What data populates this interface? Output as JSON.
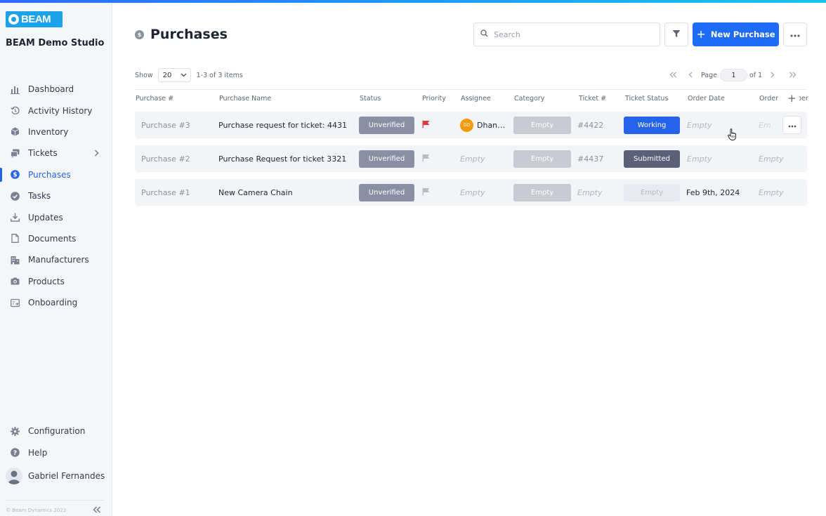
{
  "app": {
    "logo_text": "BEAM",
    "studio_name": "BEAM Demo Studio",
    "copyright": "© Beam Dynamics 2023",
    "accent_color": "#1e6cf5",
    "logo_color": "#1aa3ea"
  },
  "sidebar": {
    "items": [
      {
        "label": "Dashboard",
        "icon": "bar-chart-icon"
      },
      {
        "label": "Activity History",
        "icon": "history-icon"
      },
      {
        "label": "Inventory",
        "icon": "box-icon"
      },
      {
        "label": "Tickets",
        "icon": "tickets-icon",
        "has_submenu": true
      },
      {
        "label": "Purchases",
        "icon": "dollar-icon",
        "active": true
      },
      {
        "label": "Tasks",
        "icon": "check-circle-icon"
      },
      {
        "label": "Updates",
        "icon": "download-icon"
      },
      {
        "label": "Documents",
        "icon": "document-icon"
      },
      {
        "label": "Manufacturers",
        "icon": "building-icon"
      },
      {
        "label": "Products",
        "icon": "camera-icon"
      },
      {
        "label": "Onboarding",
        "icon": "onboarding-icon"
      }
    ],
    "bottom_items": [
      {
        "label": "Configuration",
        "icon": "gear-icon"
      },
      {
        "label": "Help",
        "icon": "help-icon"
      }
    ],
    "user_name": "Gabriel Fernandes"
  },
  "header": {
    "title": "Purchases",
    "search_placeholder": "Search",
    "new_button_label": "New Purchase"
  },
  "toolbar": {
    "show_label": "Show",
    "page_size": "20",
    "items_count": "1-3 of 3 items",
    "page_label": "Page",
    "page_number": "1",
    "of_label": "of 1"
  },
  "table": {
    "columns": [
      "Purchase #",
      "Purchase Name",
      "Status",
      "Priority",
      "Assignee",
      "Category",
      "Ticket #",
      "Ticket Status",
      "Order Date",
      "Order",
      "ber"
    ],
    "rows": [
      {
        "purchase_no": "Purchase #3",
        "name": "Purchase request for ticket: 4431",
        "status": "Unverified",
        "priority_flag": "red",
        "assignee_initials": "DD",
        "assignee": "Dhan…",
        "category": "Empty",
        "ticket_no": "#4422",
        "ticket_status": "Working",
        "order_date": "Empty",
        "order": "Em"
      },
      {
        "purchase_no": "Purchase #2",
        "name": "Purchase Request for ticket 3321",
        "status": "Unverified",
        "priority_flag": "gray",
        "assignee": "Empty",
        "category": "Empty",
        "ticket_no": "#4437",
        "ticket_status": "Submitted",
        "order_date": "Empty",
        "order": "Empty"
      },
      {
        "purchase_no": "Purchase #1",
        "name": "New Camera Chain",
        "status": "Unverified",
        "priority_flag": "gray",
        "assignee": "Empty",
        "category": "Empty",
        "ticket_no": "Empty",
        "ticket_status": "Empty",
        "order_date": "Feb 9th, 2024",
        "order": "Empty"
      }
    ]
  },
  "colors": {
    "status_unverified": "#8a8fa5",
    "ticket_working": "#2563eb",
    "ticket_submitted": "#5b6078",
    "priority_red": "#e0353b",
    "priority_gray": "#b8bcc6",
    "assignee_avatar": "#f29b0e"
  }
}
